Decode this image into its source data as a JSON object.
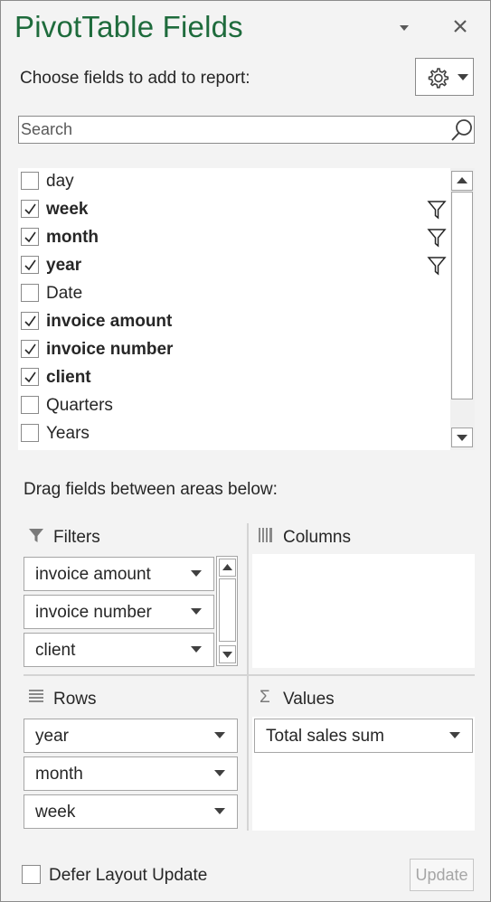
{
  "title": "PivotTable Fields",
  "choose_label": "Choose fields to add to report:",
  "search": {
    "placeholder": "Search",
    "value": ""
  },
  "fields": [
    {
      "label": "day",
      "checked": false,
      "filtered": false
    },
    {
      "label": "week",
      "checked": true,
      "filtered": true
    },
    {
      "label": "month",
      "checked": true,
      "filtered": true
    },
    {
      "label": "year",
      "checked": true,
      "filtered": true
    },
    {
      "label": "Date",
      "checked": false,
      "filtered": false
    },
    {
      "label": "invoice amount",
      "checked": true,
      "filtered": false
    },
    {
      "label": "invoice number",
      "checked": true,
      "filtered": false
    },
    {
      "label": "client",
      "checked": true,
      "filtered": false
    },
    {
      "label": "Quarters",
      "checked": false,
      "filtered": false
    },
    {
      "label": "Years",
      "checked": false,
      "filtered": false
    }
  ],
  "drag_label": "Drag fields between areas below:",
  "areas": {
    "filters": {
      "title": "Filters",
      "items": [
        "invoice amount",
        "invoice number",
        "client"
      ]
    },
    "columns": {
      "title": "Columns",
      "items": []
    },
    "rows": {
      "title": "Rows",
      "items": [
        "year",
        "month",
        "week"
      ]
    },
    "values": {
      "title": "Values",
      "items": [
        "Total sales sum"
      ]
    }
  },
  "defer_label": "Defer Layout Update",
  "update_label": "Update",
  "colors": {
    "title_green": "#1e6b3c",
    "pane_bg": "#f3f3f3",
    "border": "#8a8a8a"
  },
  "icons": {
    "settings": "gear-icon",
    "search": "search-icon",
    "filter": "funnel-icon",
    "columns": "columns-icon",
    "rows": "rows-icon",
    "values": "sigma-icon",
    "close": "close-icon"
  }
}
